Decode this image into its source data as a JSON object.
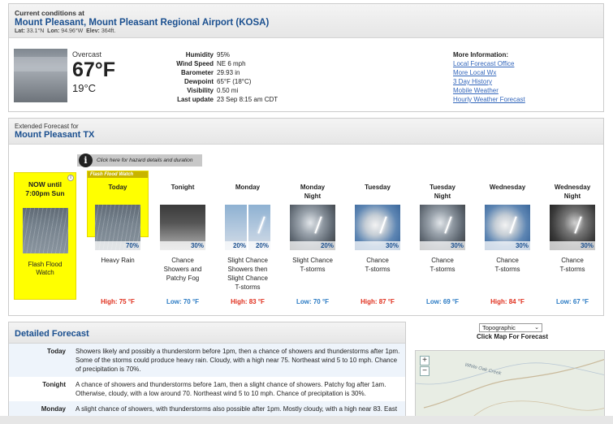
{
  "current": {
    "header": "Current conditions at",
    "location": "Mount Pleasant, Mount Pleasant Regional Airport (KOSA)",
    "lat_label": "Lat:",
    "lat": "33.1°N",
    "lon_label": "Lon:",
    "lon": "94.96°W",
    "elev_label": "Elev:",
    "elev": "364ft.",
    "condition": "Overcast",
    "temp_f": "67°F",
    "temp_c": "19°C",
    "details": [
      {
        "label": "Humidity",
        "value": "95%"
      },
      {
        "label": "Wind Speed",
        "value": "NE 6 mph"
      },
      {
        "label": "Barometer",
        "value": "29.93 in"
      },
      {
        "label": "Dewpoint",
        "value": "65°F (18°C)"
      },
      {
        "label": "Visibility",
        "value": "0.50 mi"
      },
      {
        "label": "Last update",
        "value": "23 Sep 8:15 am CDT"
      }
    ],
    "more_info_title": "More Information:",
    "links": [
      "Local Forecast Office",
      "More Local Wx",
      "3 Day History",
      "Mobile Weather",
      "Hourly Weather Forecast"
    ]
  },
  "extended": {
    "subheader": "Extended Forecast for",
    "location": "Mount Pleasant TX",
    "hazard_hint": "Click here for hazard details and duration",
    "now_title_line1": "NOW until",
    "now_title_line2": "7:00pm Sun",
    "now_label_line1": "Flash Flood",
    "now_label_line2": "Watch",
    "ffw_tag": "Flash Flood Watch",
    "periods": [
      {
        "name1": "Today",
        "name2": "",
        "pop": "70%",
        "desc1": "Heavy Rain",
        "desc2": "",
        "desc3": "",
        "desc4": "",
        "temp": "High: 75 °F",
        "kind": "hi",
        "icon": "heavy-rain-icon"
      },
      {
        "name1": "Tonight",
        "name2": "",
        "pop": "30%",
        "desc1": "Chance",
        "desc2": "Showers and",
        "desc3": "Patchy Fog",
        "desc4": "",
        "temp": "Low: 70 °F",
        "kind": "lo",
        "icon": "showers-fog-icon"
      },
      {
        "name1": "Monday",
        "name2": "",
        "pop": "20%",
        "pop2": "20%",
        "desc1": "Slight Chance",
        "desc2": "Showers then",
        "desc3": "Slight Chance",
        "desc4": "T-storms",
        "temp": "High: 83 °F",
        "kind": "hi",
        "icon": "showers-tstorms-icon"
      },
      {
        "name1": "Monday",
        "name2": "Night",
        "pop": "20%",
        "desc1": "Slight Chance",
        "desc2": "T-storms",
        "desc3": "",
        "desc4": "",
        "temp": "Low: 70 °F",
        "kind": "lo",
        "icon": "tstorms-icon"
      },
      {
        "name1": "Tuesday",
        "name2": "",
        "pop": "30%",
        "desc1": "Chance",
        "desc2": "T-storms",
        "desc3": "",
        "desc4": "",
        "temp": "High: 87 °F",
        "kind": "hi",
        "icon": "tstorms-icon"
      },
      {
        "name1": "Tuesday",
        "name2": "Night",
        "pop": "30%",
        "desc1": "Chance",
        "desc2": "T-storms",
        "desc3": "",
        "desc4": "",
        "temp": "Low: 69 °F",
        "kind": "lo",
        "icon": "tstorms-icon"
      },
      {
        "name1": "Wednesday",
        "name2": "",
        "pop": "30%",
        "desc1": "Chance",
        "desc2": "T-storms",
        "desc3": "",
        "desc4": "",
        "temp": "High: 84 °F",
        "kind": "hi",
        "icon": "tstorms-icon"
      },
      {
        "name1": "Wednesday",
        "name2": "Night",
        "pop": "30%",
        "desc1": "Chance",
        "desc2": "T-storms",
        "desc3": "",
        "desc4": "",
        "temp": "Low: 67 °F",
        "kind": "lo",
        "icon": "tstorms-icon"
      }
    ]
  },
  "detailed": {
    "title": "Detailed Forecast",
    "rows": [
      {
        "day": "Today",
        "text": "Showers likely and possibly a thunderstorm before 1pm, then a chance of showers and thunderstorms after 1pm. Some of the storms could produce heavy rain. Cloudy, with a high near 75. Northeast wind 5 to 10 mph. Chance of precipitation is 70%."
      },
      {
        "day": "Tonight",
        "text": "A chance of showers and thunderstorms before 1am, then a slight chance of showers. Patchy fog after 1am. Otherwise, cloudy, with a low around 70. Northeast wind 5 to 10 mph. Chance of precipitation is 30%."
      },
      {
        "day": "Monday",
        "text": "A slight chance of showers, with thunderstorms also possible after 1pm. Mostly cloudy, with a high near 83. East"
      }
    ]
  },
  "map": {
    "select_value": "Topographic",
    "caption": "Click Map For Forecast",
    "zoom_in": "+",
    "zoom_out": "−",
    "creek_label": "White Oak Creek"
  }
}
